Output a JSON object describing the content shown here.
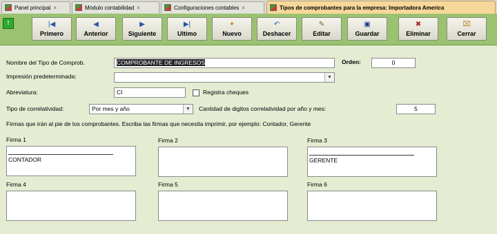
{
  "tabs": [
    {
      "label": "Panel principal"
    },
    {
      "label": "Módulo contabilidad"
    },
    {
      "label": "Configuraciones contables"
    },
    {
      "label": "Tipos de comprobantes para la empresa: Importadora America"
    }
  ],
  "toolbar": {
    "buttons": [
      {
        "label": "Primero",
        "icon": "first-icon"
      },
      {
        "label": "Anterior",
        "icon": "previous-icon"
      },
      {
        "label": "Siguiente",
        "icon": "next-icon"
      },
      {
        "label": "Ultimo",
        "icon": "last-icon"
      },
      {
        "label": "Nuevo",
        "icon": "new-icon"
      },
      {
        "label": "Deshacer",
        "icon": "undo-icon"
      },
      {
        "label": "Editar",
        "icon": "pencil-icon"
      },
      {
        "label": "Guardar",
        "icon": "save-icon"
      },
      {
        "label": "Eliminar",
        "icon": "delete-icon"
      },
      {
        "label": "Cerrar",
        "icon": "close-icon"
      }
    ]
  },
  "form": {
    "nombre_label": "Nombre del Tipo de Comprob.",
    "nombre_value": "COMPROBANTE DE INGRESOS",
    "orden_label": "Orden:",
    "orden_value": "0",
    "impresion_label": "Impresión predeterminada:",
    "impresion_value": "",
    "abreviatura_label": "Abreviatura:",
    "abreviatura_value": "CI",
    "registra_label": "Registra cheques",
    "registra_checked": false,
    "correlatividad_label": "Tipo de correlatividad:",
    "correlatividad_value": "Por mes y año",
    "digitos_label": "Cantidad de digitos correlatividad por año y mes:",
    "digitos_value": "5",
    "firmas_info": "Firmas que irán al pie de los comprobantes. Escriba las firmas que necesita imprimir, por ejemplo: Contador, Gerente"
  },
  "firmas": [
    {
      "label": "Firma 1",
      "text": "CONTADOR",
      "line": true
    },
    {
      "label": "Firma 2",
      "text": "",
      "line": false
    },
    {
      "label": "Firma 3",
      "text": "GERENTE",
      "line": true
    },
    {
      "label": "Firma 4",
      "text": "",
      "line": false
    },
    {
      "label": "Firma 5",
      "text": "",
      "line": false
    },
    {
      "label": "Firma 6",
      "text": "",
      "line": false
    }
  ],
  "colors": {
    "toolbar_green": "#9ac270",
    "panel_bg": "#e4ecd2",
    "active_tab": "#f8d89a"
  }
}
